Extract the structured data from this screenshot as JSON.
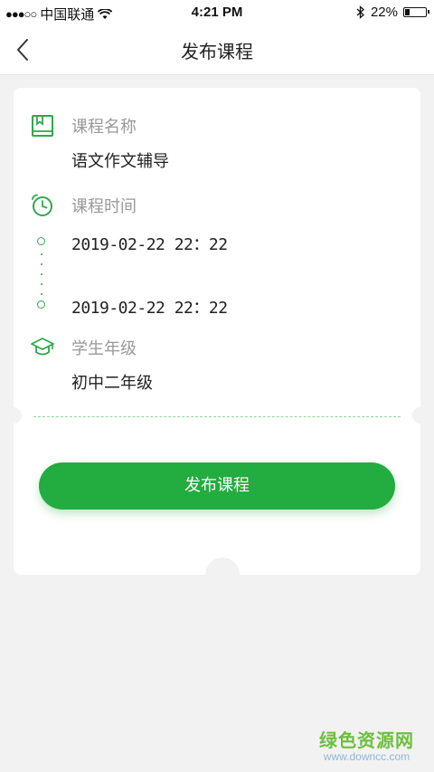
{
  "status_bar": {
    "carrier": "中国联通",
    "time": "4:21 PM",
    "battery_percent": "22%",
    "battery_level": 0.22
  },
  "nav": {
    "title": "发布课程"
  },
  "course": {
    "name_label": "课程名称",
    "name_value": "语文作文辅导",
    "time_label": "课程时间",
    "start_time": "2019-02-22  22：22",
    "end_time": "2019-02-22  22：22",
    "grade_label": "学生年级",
    "grade_value": "初中二年级"
  },
  "actions": {
    "publish_label": "发布课程"
  },
  "watermark": {
    "main": "绿色资源网",
    "sub": "www.downcc.com"
  },
  "colors": {
    "accent": "#23ac3f",
    "label_gray": "#999999",
    "background": "#f2f2f2"
  },
  "icons": [
    "back-arrow-icon",
    "book-icon",
    "alarm-clock-icon",
    "graduation-cap-icon",
    "wifi-icon",
    "bluetooth-icon",
    "battery-icon"
  ]
}
